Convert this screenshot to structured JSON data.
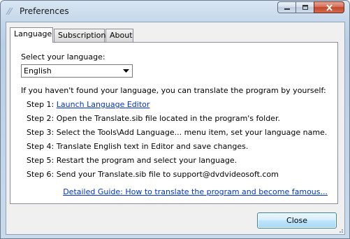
{
  "window": {
    "title": "Preferences"
  },
  "tabs": [
    {
      "label": "Language",
      "active": true
    },
    {
      "label": "Subscription",
      "active": false
    },
    {
      "label": "About",
      "active": false
    }
  ],
  "language": {
    "select_label": "Select your language:",
    "selected": "English",
    "intro": "If you haven't found your language, you can translate the program by yourself:",
    "step1_prefix": "Step 1: ",
    "step1_link": "Launch Language Editor",
    "steps": [
      "Step 2: Open the Translate.sib file located in the program's folder.",
      "Step 3: Select the Tools\\Add Language... menu item, set your language name.",
      "Step 4: Translate English text in Editor and save changes.",
      "Step 5: Restart the program and select your language.",
      "Step 6: Send your Translate.sib file to support@dvdvideosoft.com"
    ],
    "guide_link": "Detailed Guide: How to translate the program and become famous..."
  },
  "buttons": {
    "close": "Close"
  },
  "colors": {
    "link": "#0033cc",
    "close_caption": "#c0482c"
  },
  "icons": {
    "app": "app-icon",
    "minimize": "minimize-icon",
    "maximize": "maximize-icon",
    "close": "close-icon",
    "dropdown": "chevron-down-icon"
  }
}
